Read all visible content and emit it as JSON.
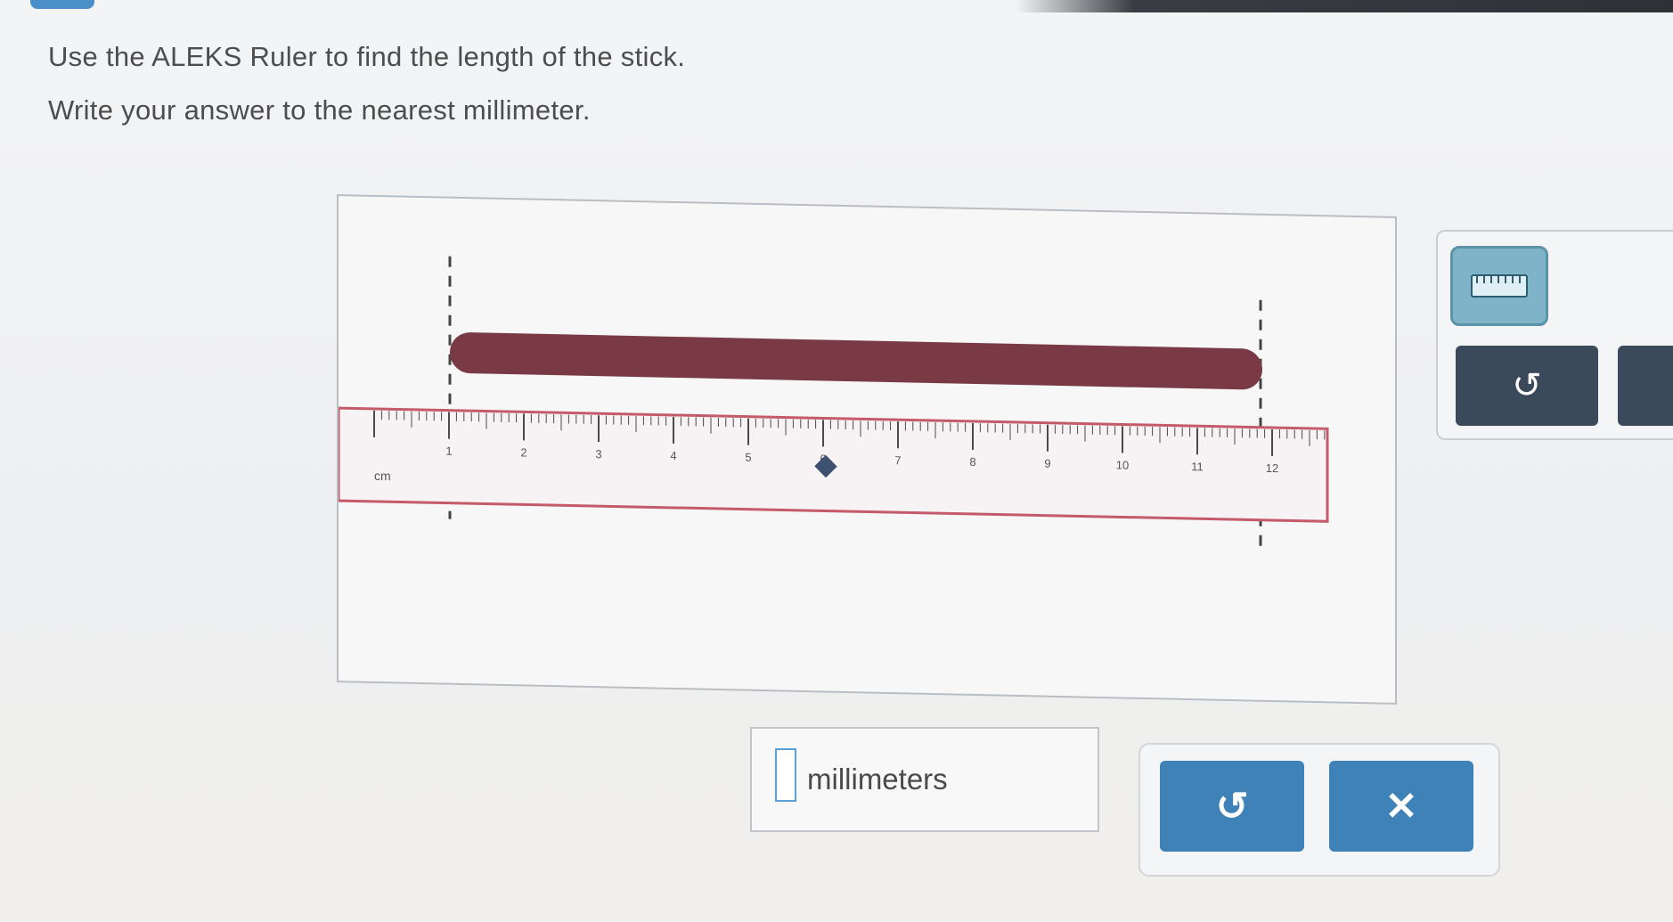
{
  "header": {
    "instruction_line1": "Use the ALEKS Ruler to find the length of the stick.",
    "instruction_line2": "Write your answer to the nearest millimeter."
  },
  "ruler": {
    "labels": [
      "1",
      "2",
      "3",
      "4",
      "5",
      "6",
      "7",
      "8",
      "9",
      "10",
      "11",
      "12"
    ],
    "unit_label": "cm"
  },
  "stick": {
    "color": "#7a3a45"
  },
  "tools": {
    "ruler_icon": "ruler-icon",
    "reset_icon": "undo-icon",
    "reset_glyph": "↺"
  },
  "answer": {
    "value": "",
    "unit": "millimeters"
  },
  "actions": {
    "undo_glyph": "↺",
    "clear_glyph": "✕"
  },
  "colors": {
    "accent": "#3e82b8",
    "ruler_border": "#c45a6a",
    "tool_dark": "#3b4a5a"
  }
}
